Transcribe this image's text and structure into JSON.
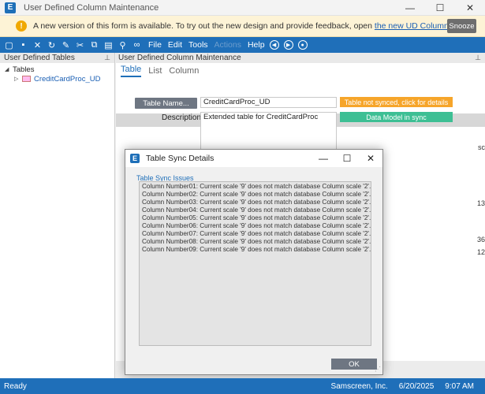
{
  "window": {
    "title": "User Defined Column Maintenance",
    "logo_letter": "E",
    "controls": [
      "—",
      "☐",
      "✕"
    ]
  },
  "banner": {
    "text": "A new version of this form is available. To try out the new design and provide feedback, open ",
    "link": "the new UD Column",
    "snooze_label": "Snooze"
  },
  "toolbar": {
    "menus": [
      "File",
      "Edit",
      "Tools",
      "Actions",
      "Help"
    ]
  },
  "left_panel": {
    "title": "User Defined Tables",
    "tree_root": "Tables",
    "tree_child": "CreditCardProc_UD"
  },
  "right_panel": {
    "title": "User Defined Column Maintenance",
    "tabs": [
      "Table",
      "List",
      "Column"
    ],
    "table_name_button": "Table Name...",
    "table_name_value": "CreditCardProc_UD",
    "description_label": "Description:",
    "description_value": "Extended table for CreditCardProc",
    "status_not_synced": "Table not synced, click for details",
    "status_data_model": "Data Model in sync",
    "edge_texts": [
      "sc",
      "13",
      "36",
      "12"
    ]
  },
  "dialog": {
    "title": "Table Sync Details",
    "issues_label": "Table Sync Issues",
    "issues": [
      "Column Number01: Current scale '9' does not match database Column scale '2'.",
      "Column Number02: Current scale '9' does not match database Column scale '2'.",
      "Column Number03: Current scale '9' does not match database Column scale '2'.",
      "Column Number04: Current scale '9' does not match database Column scale '2'.",
      "Column Number05: Current scale '9' does not match database Column scale '2'.",
      "Column Number06: Current scale '9' does not match database Column scale '2'.",
      "Column Number07: Current scale '9' does not match database Column scale '2'.",
      "Column Number08: Current scale '9' does not match database Column scale '2'.",
      "Column Number09: Current scale '9' does not match database Column scale '2'."
    ],
    "ok_label": "OK"
  },
  "statusbar": {
    "left": "Ready",
    "company": "Samscreen, Inc.",
    "date": "6/20/2025",
    "time": "9:07 AM"
  },
  "colors": {
    "brand_blue": "#1f6fb9",
    "warning_orange": "#f6a52a",
    "sync_green": "#3dbf94",
    "banner_bg": "#fdf3d6"
  }
}
